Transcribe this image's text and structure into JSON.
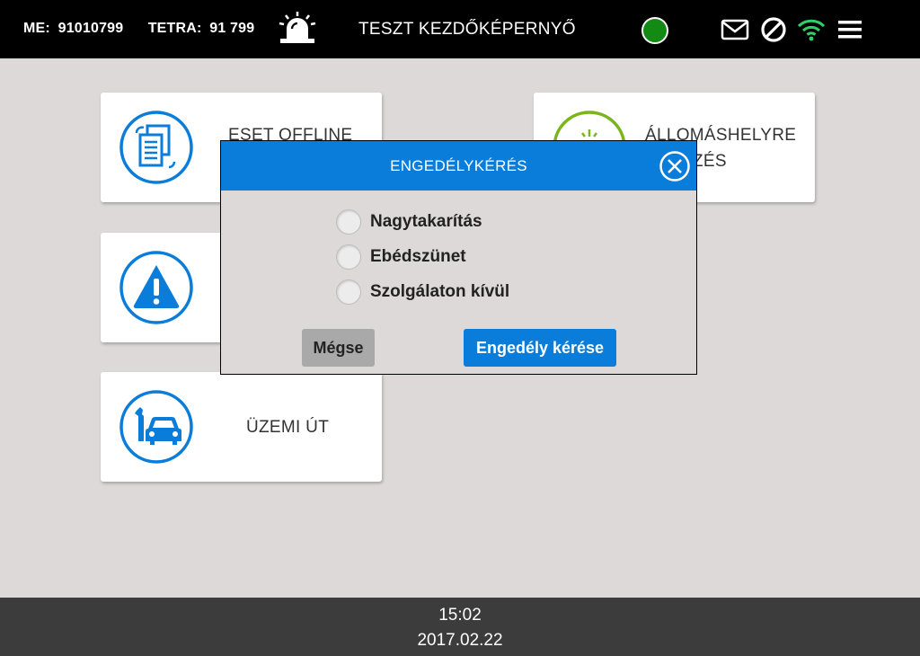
{
  "topbar": {
    "me_label": "ME:",
    "me_value": "91010799",
    "tetra_label": "TETRA:",
    "tetra_value": "91 799",
    "title": "TESZT KEZDŐKÉPERNYŐ",
    "status_color": "#138a13",
    "icons": [
      "siren-icon",
      "status-indicator",
      "mail-icon",
      "block-icon",
      "wifi-icon",
      "menu-icon"
    ]
  },
  "cards": {
    "offline": {
      "line1": "ESET OFFLINE",
      "icon": "documents-sync-icon"
    },
    "alert": {
      "line1": "",
      "icon": "warning-icon"
    },
    "station": {
      "line1": "ÁLLOMÁSHELYRE",
      "line2": "ÉRKEZÉS",
      "icon": "station-icon"
    },
    "service": {
      "line1": "ÜZEMI ÚT",
      "icon": "car-service-icon"
    }
  },
  "dialog": {
    "title": "ENGEDÉLYKÉRÉS",
    "options": [
      {
        "label": "Nagytakarítás"
      },
      {
        "label": "Ebédszünet"
      },
      {
        "label": "Szolgálaton kívül"
      }
    ],
    "cancel_label": "Mégse",
    "submit_label": "Engedély kérése"
  },
  "footer": {
    "time": "15:02",
    "date": "2017.02.22"
  },
  "colors": {
    "accent": "#0a7ddb",
    "station_green": "#7ab51d",
    "background": "#dcd9d8"
  }
}
